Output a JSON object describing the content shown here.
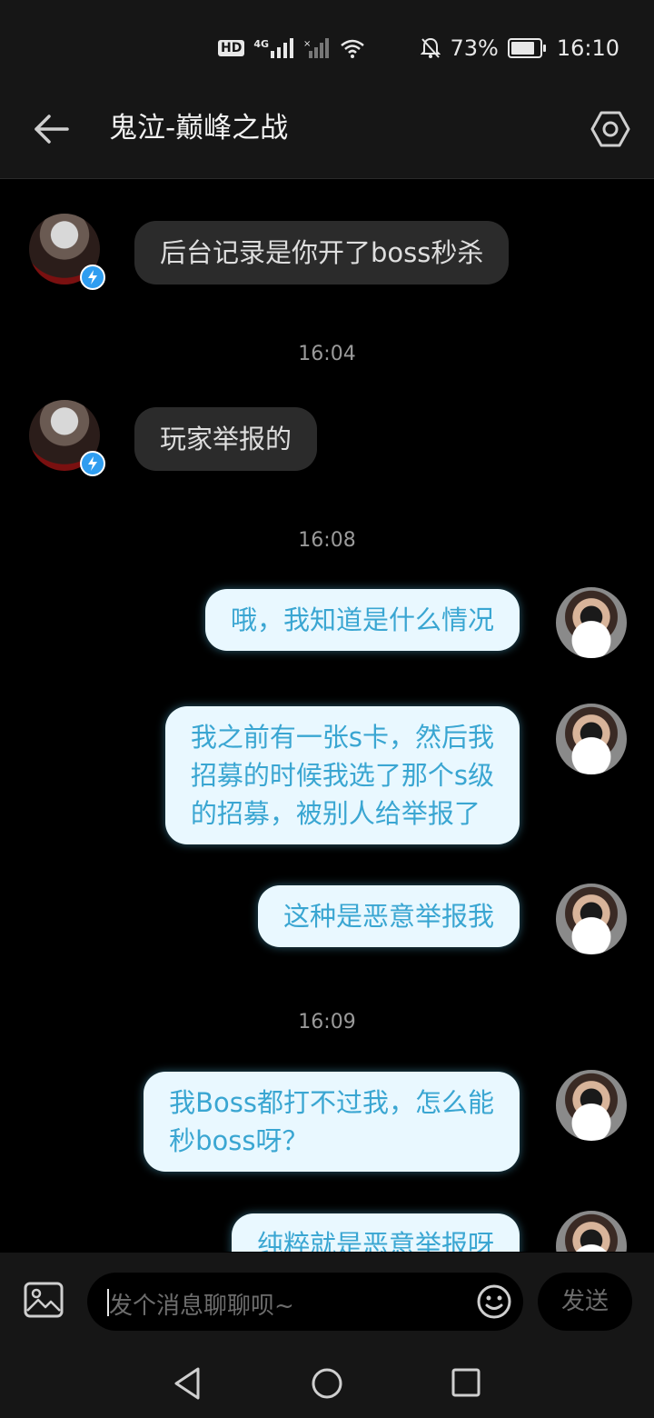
{
  "status_bar": {
    "hd_label": "HD",
    "network_label": "4G",
    "battery_percent": "73%",
    "battery_level": 0.73,
    "time": "16:10"
  },
  "header": {
    "title": "鬼泣-巅峰之战",
    "back_icon": "arrow-left-icon",
    "settings_icon": "hexagon-settings-icon"
  },
  "messages": [
    {
      "sender": "other",
      "text": "后台记录是你开了boss秒杀"
    },
    {
      "type": "timestamp",
      "text": "16:04"
    },
    {
      "sender": "other",
      "text": "玩家举报的"
    },
    {
      "type": "timestamp",
      "text": "16:08"
    },
    {
      "sender": "me",
      "text": "哦，我知道是什么情况"
    },
    {
      "sender": "me",
      "lines": [
        "我之前有一张s卡，然后我",
        "招募的时候我选了那个s级",
        "的招募，被别人给举报了"
      ]
    },
    {
      "sender": "me",
      "text": "这种是恶意举报我"
    },
    {
      "type": "timestamp",
      "text": "16:09"
    },
    {
      "sender": "me",
      "lines": [
        "我Boss都打不过我，怎么能",
        "秒boss呀？"
      ]
    },
    {
      "sender": "me",
      "text": "纯粹就是恶意举报呀"
    }
  ],
  "input_bar": {
    "placeholder": "发个消息聊聊呗~",
    "send_label": "发送",
    "image_icon": "image-icon",
    "emoji_icon": "emoji-icon"
  },
  "colors": {
    "outgoing_bubble": "#e9f8ff",
    "outgoing_text": "#3aa6d2",
    "incoming_bubble": "#2b2b2b"
  }
}
